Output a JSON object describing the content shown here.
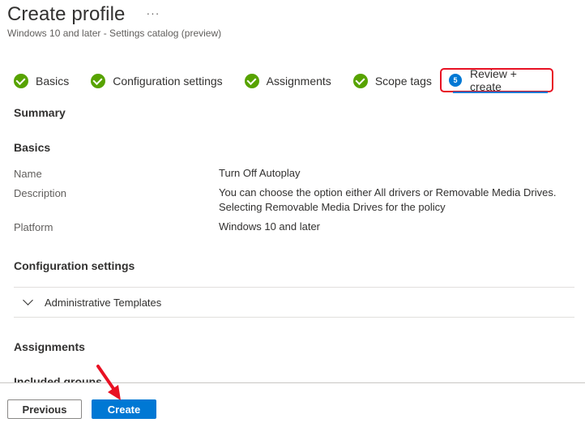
{
  "header": {
    "title": "Create profile",
    "more_icon": "···",
    "subtitle": "Windows 10 and later - Settings catalog (preview)"
  },
  "steps": [
    {
      "label": "Basics",
      "status": "complete"
    },
    {
      "label": "Configuration settings",
      "status": "complete"
    },
    {
      "label": "Assignments",
      "status": "complete"
    },
    {
      "label": "Scope tags",
      "status": "complete"
    },
    {
      "label": "Review + create",
      "status": "active",
      "number": "5"
    }
  ],
  "summary": {
    "heading": "Summary",
    "basics": {
      "heading": "Basics",
      "fields": [
        {
          "label": "Name",
          "value": "Turn Off Autoplay"
        },
        {
          "label": "Description",
          "value_lines": [
            "You can choose the option either All drivers or Removable Media Drives.",
            "Selecting Removable Media Drives for the policy"
          ]
        },
        {
          "label": "Platform",
          "value": "Windows 10 and later"
        }
      ]
    },
    "configuration": {
      "heading": "Configuration settings",
      "accordion_label": "Administrative Templates"
    },
    "assignments": {
      "heading": "Assignments",
      "included_groups": "Included groups"
    }
  },
  "footer": {
    "previous_label": "Previous",
    "create_label": "Create"
  },
  "colors": {
    "accent": "#0078d4",
    "success": "#57a300",
    "highlight": "#e81123"
  }
}
